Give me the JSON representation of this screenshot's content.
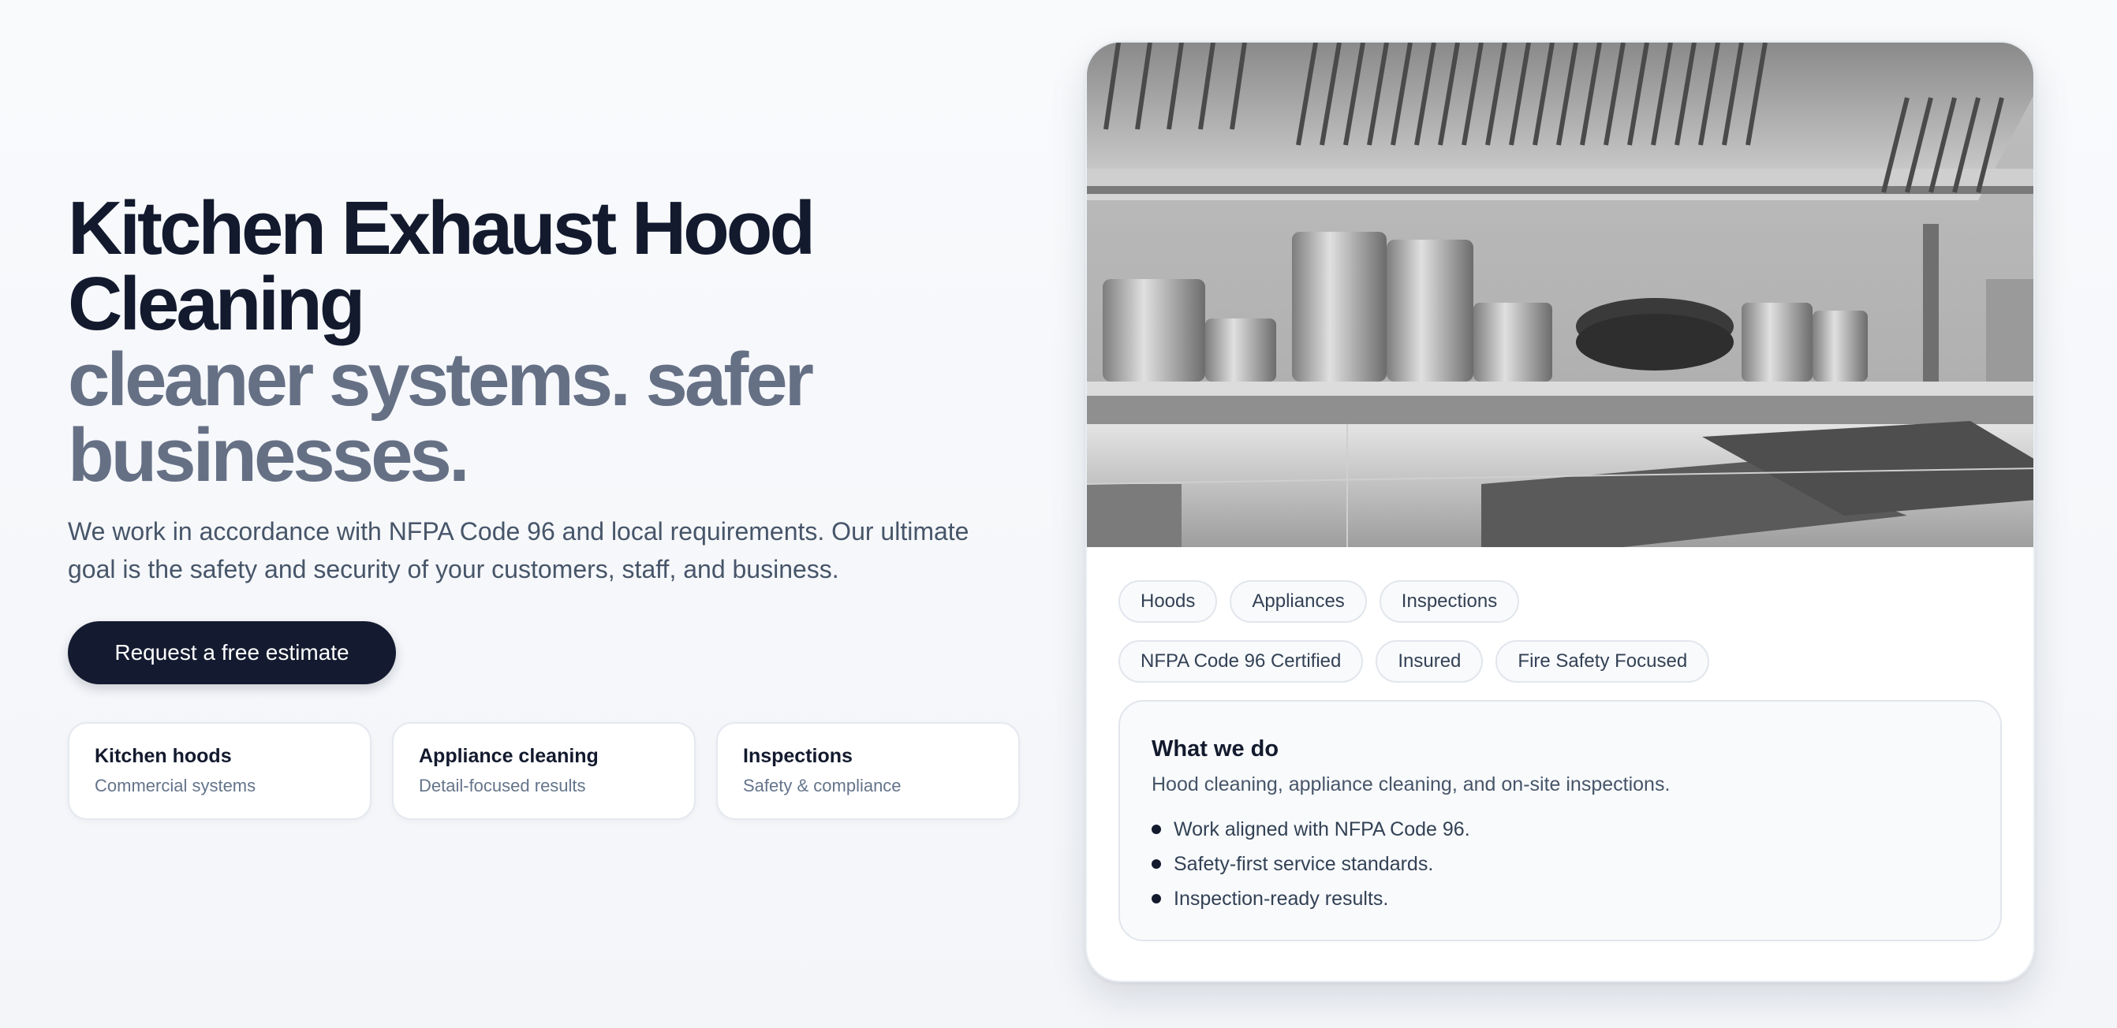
{
  "hero": {
    "title_line1": "Kitchen Exhaust Hood",
    "title_line2": "Cleaning",
    "subtitle_line1": "cleaner systems. safer",
    "subtitle_line2": "businesses.",
    "lead": "We work in accordance with NFPA Code 96 and local requirements. Our ultimate goal is the safety and security of your customers, staff, and business.",
    "cta_label": "Request a free estimate"
  },
  "feature_cards": [
    {
      "title": "Kitchen hoods",
      "subtitle": "Commercial systems"
    },
    {
      "title": "Appliance cleaning",
      "subtitle": "Detail-focused results"
    },
    {
      "title": "Inspections",
      "subtitle": "Safety & compliance"
    }
  ],
  "panel": {
    "image_alt": "commercial-kitchen-photo",
    "tags_row1": [
      "Hoods",
      "Appliances",
      "Inspections"
    ],
    "tags_row2": [
      "NFPA Code 96 Certified",
      "Insured",
      "Fire Safety Focused"
    ],
    "info": {
      "title": "What we do",
      "description": "Hood cleaning, appliance cleaning, and on-site inspections.",
      "items": [
        "Work aligned with NFPA Code 96.",
        "Safety-first service standards.",
        "Inspection-ready results."
      ]
    }
  },
  "colors": {
    "primary": "#141b30",
    "heading": "#131a2e",
    "subheading": "#667085",
    "body": "#475569",
    "background": "#f8fafc"
  }
}
